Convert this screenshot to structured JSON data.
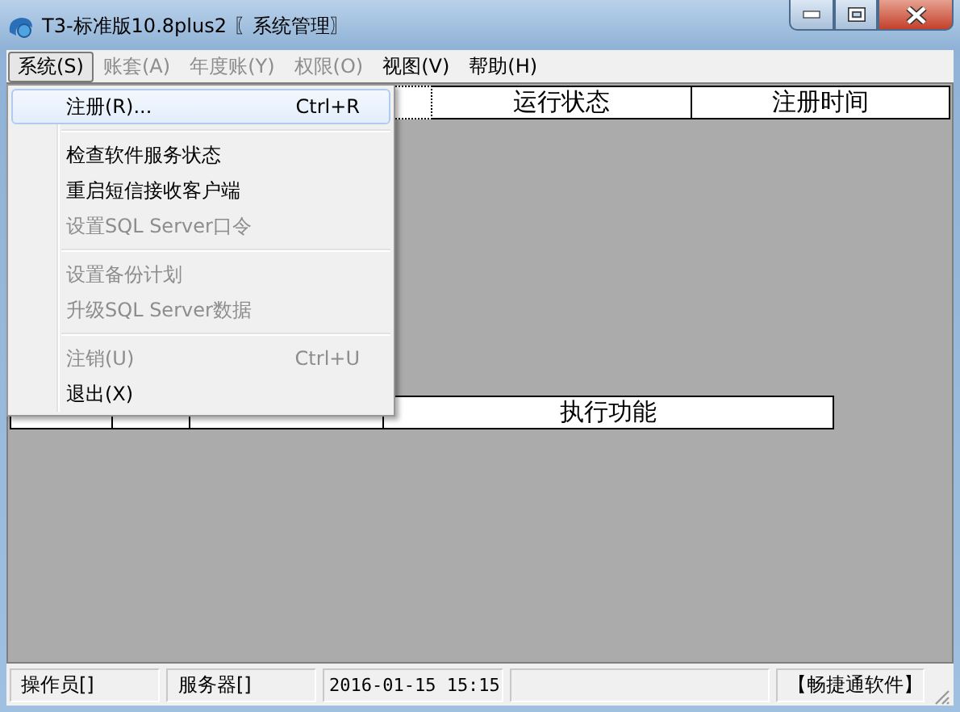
{
  "window": {
    "title": "T3-标准版10.8plus2 〖系统管理〗"
  },
  "menu_bar": [
    {
      "label": "系统(S)",
      "selected": true,
      "disabled": false
    },
    {
      "label": "账套(A)",
      "selected": false,
      "disabled": true
    },
    {
      "label": "年度账(Y)",
      "selected": false,
      "disabled": true
    },
    {
      "label": "权限(O)",
      "selected": false,
      "disabled": true
    },
    {
      "label": "视图(V)",
      "selected": false,
      "disabled": false
    },
    {
      "label": "帮助(H)",
      "selected": false,
      "disabled": false
    }
  ],
  "dropdown_menu": [
    {
      "kind": "item",
      "label": "注册(R)...",
      "shortcut": "Ctrl+R",
      "selected": true,
      "disabled": false
    },
    {
      "kind": "separator"
    },
    {
      "kind": "item",
      "label": "检查软件服务状态",
      "selected": false,
      "disabled": false
    },
    {
      "kind": "item",
      "label": "重启短信接收客户端",
      "selected": false,
      "disabled": false
    },
    {
      "kind": "item",
      "label": "设置SQL Server口令",
      "selected": false,
      "disabled": true
    },
    {
      "kind": "separator"
    },
    {
      "kind": "item",
      "label": "设置备份计划",
      "selected": false,
      "disabled": true
    },
    {
      "kind": "item",
      "label": "升级SQL Server数据",
      "selected": false,
      "disabled": true
    },
    {
      "kind": "separator"
    },
    {
      "kind": "item",
      "label": "注销(U)",
      "shortcut": "Ctrl+U",
      "selected": false,
      "disabled": true
    },
    {
      "kind": "item",
      "label": "退出(X)",
      "selected": false,
      "disabled": false
    }
  ],
  "upper_table": {
    "columns": [
      "运行状态",
      "注册时间"
    ]
  },
  "lower_table": {
    "columns": [
      null,
      null,
      null,
      "执行功能"
    ]
  },
  "status_bar": [
    {
      "kind": "text",
      "text": "操作员[]"
    },
    {
      "kind": "text",
      "text": "服务器[]"
    },
    {
      "kind": "text",
      "text": "2016-01-15 15:15"
    },
    {
      "kind": "blank"
    },
    {
      "kind": "text",
      "text": "【畅捷通软件】"
    }
  ]
}
